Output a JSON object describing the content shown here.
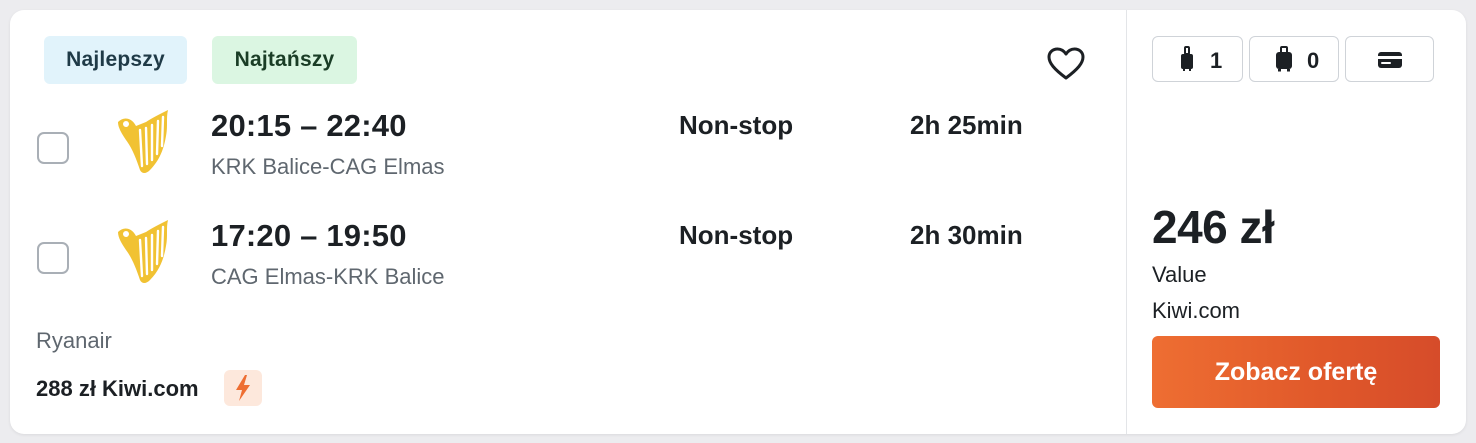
{
  "tags": {
    "best": "Najlepszy",
    "cheapest": "Najtańszy"
  },
  "flights": [
    {
      "times": "20:15 – 22:40",
      "route": "KRK Balice-CAG Elmas",
      "stops": "Non-stop",
      "duration": "2h 25min"
    },
    {
      "times": "17:20 – 19:50",
      "route": "CAG Elmas-KRK Balice",
      "stops": "Non-stop",
      "duration": "2h 30min"
    }
  ],
  "airline": "Ryanair",
  "alternative_price": "288 zł Kiwi.com",
  "bags": {
    "personal_count": "1",
    "carry_on_count": "0"
  },
  "offer": {
    "price": "246 zł",
    "deal_label": "Value",
    "provider": "Kiwi.com",
    "cta_label": "Zobacz ofertę"
  },
  "colors": {
    "accent": "#e65f2c",
    "tag_best_bg": "#e1f3fb",
    "tag_cheap_bg": "#dbf6e2",
    "airline_logo": "#f1c233"
  },
  "icons": {
    "favorite": "heart-icon",
    "airline_logo": "ryanair-harp-logo",
    "personal_bag": "personal-bag-icon",
    "carry_on": "carry-on-bag-icon",
    "payment": "credit-card-icon",
    "bolt": "lightning-icon"
  }
}
